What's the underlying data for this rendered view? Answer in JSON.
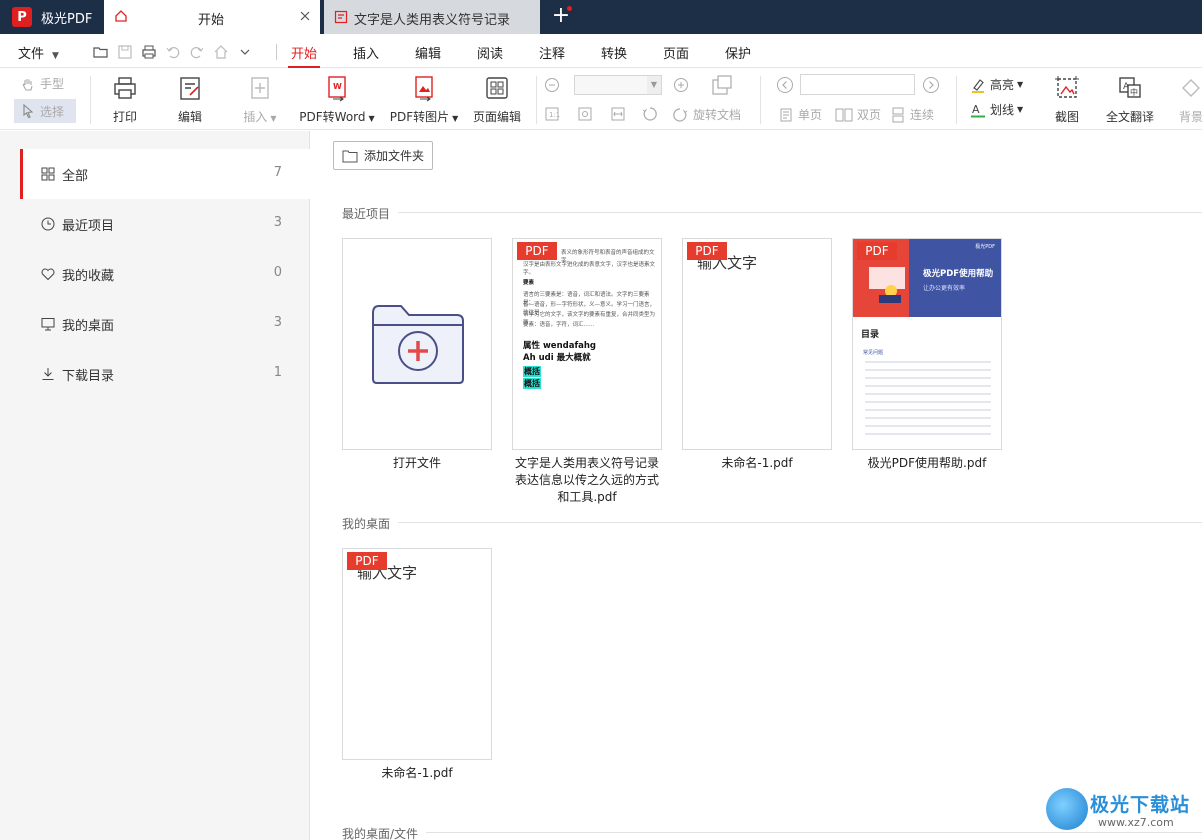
{
  "app": {
    "logo_letter": "P",
    "title": "极光PDF"
  },
  "tabs": [
    {
      "label": "开始",
      "icon": "home-icon"
    },
    {
      "label": "文字是人类用表义符号记录...",
      "icon": "pdf-doc-icon"
    }
  ],
  "menubar": {
    "file_label": "文件",
    "tabs": [
      "开始",
      "插入",
      "编辑",
      "阅读",
      "注释",
      "转换",
      "页面",
      "保护"
    ],
    "active_tab": "开始"
  },
  "ribbon": {
    "hand": "手型",
    "select": "选择",
    "print": "打印",
    "edit": "编辑",
    "insert": "插入",
    "pdf_to_word": "PDF转Word",
    "pdf_to_image": "PDF转图片",
    "page_edit": "页面编辑",
    "rotate_doc": "旋转文档",
    "single_page": "单页",
    "double_page": "双页",
    "continuous": "连续",
    "highlight": "高亮",
    "strikeline": "划线",
    "screenshot": "截图",
    "full_translate": "全文翻译",
    "background": "背景"
  },
  "sidebar": {
    "items": [
      {
        "label": "全部",
        "count": "7",
        "icon": "grid-icon"
      },
      {
        "label": "最近项目",
        "count": "3",
        "icon": "clock-icon"
      },
      {
        "label": "我的收藏",
        "count": "0",
        "icon": "heart-icon"
      },
      {
        "label": "我的桌面",
        "count": "3",
        "icon": "monitor-icon"
      },
      {
        "label": "下载目录",
        "count": "1",
        "icon": "download-icon"
      }
    ]
  },
  "main": {
    "add_folder": "添加文件夹",
    "sections": {
      "recent": "最近项目",
      "desktop": "我的桌面",
      "desktop_files": "我的桌面/文件"
    },
    "recent_files": [
      {
        "label": "打开文件"
      },
      {
        "label_lines": [
          "文字是人类用表义符号记录",
          "表达信息以传之久远的方式",
          "和工具.pdf"
        ],
        "badge": "PDF"
      },
      {
        "label": "未命名-1.pdf",
        "badge": "PDF",
        "handwriting": "输入文字"
      },
      {
        "label": "极光PDF使用帮助.pdf",
        "badge": "PDF"
      }
    ],
    "desktop_files": [
      {
        "label": "未命名-1.pdf",
        "badge": "PDF",
        "handwriting": "输入文字"
      }
    ],
    "doc_preview": {
      "lines": [
        "表义的象形符号和表音的声音组成的文字，",
        "汉字是由表形文字进化成的表意文字，汉字也是语素文字。",
        "语言的三要素是：语音，词汇和语法。文字的三要素是：",
        "音—语音，形—字符形状，义—意义。学习一门语言，往往是",
        "带学习它的文字，该文字的要素有重复，合并同类型为两",
        "要素：语音，字符，词汇……"
      ],
      "small_heading": "要素",
      "bold1": "属性 wendafahg",
      "bold2": "Ah udi 最大概就",
      "hl1": "概括",
      "hl2": "概括"
    },
    "help_preview": {
      "brand": "极光PDF",
      "title": "极光PDF使用帮助",
      "subtitle": "让办公更有效率",
      "toc": "目录",
      "faq": "常见问题"
    }
  },
  "watermark": {
    "name": "极光下载站",
    "url": "www.xz7.com"
  },
  "colors": {
    "accent": "#e02020",
    "titlebar": "#1d2e47",
    "pdf_badge": "#e63c2e",
    "sidebar_bg": "#f5f5f5"
  }
}
